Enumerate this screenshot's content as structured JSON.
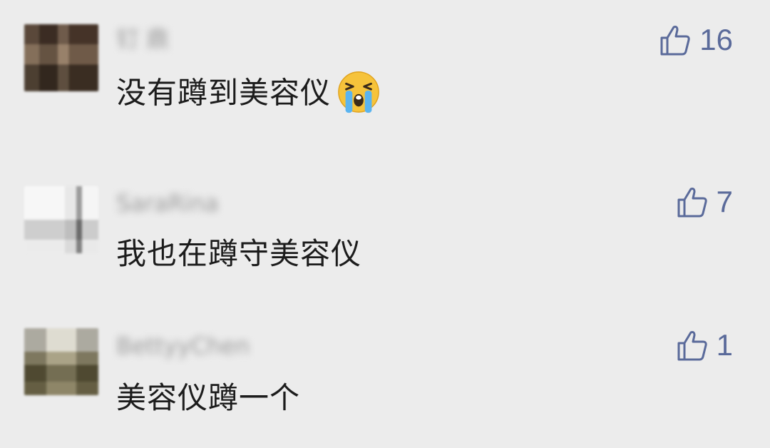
{
  "comments": [
    {
      "username": "钉 鼎",
      "text": "没有蹲到美容仪",
      "emoji": "loudly-crying-face",
      "likes": "16"
    },
    {
      "username": "SaraRina",
      "text": "我也在蹲守美容仪",
      "likes": "7"
    },
    {
      "username": "BettyyChen",
      "text": "美容仪蹲一个",
      "likes": "1"
    }
  ],
  "colors": {
    "background": "#ececec",
    "like_accent": "#5a6a9a",
    "text": "#1c1c1c"
  }
}
